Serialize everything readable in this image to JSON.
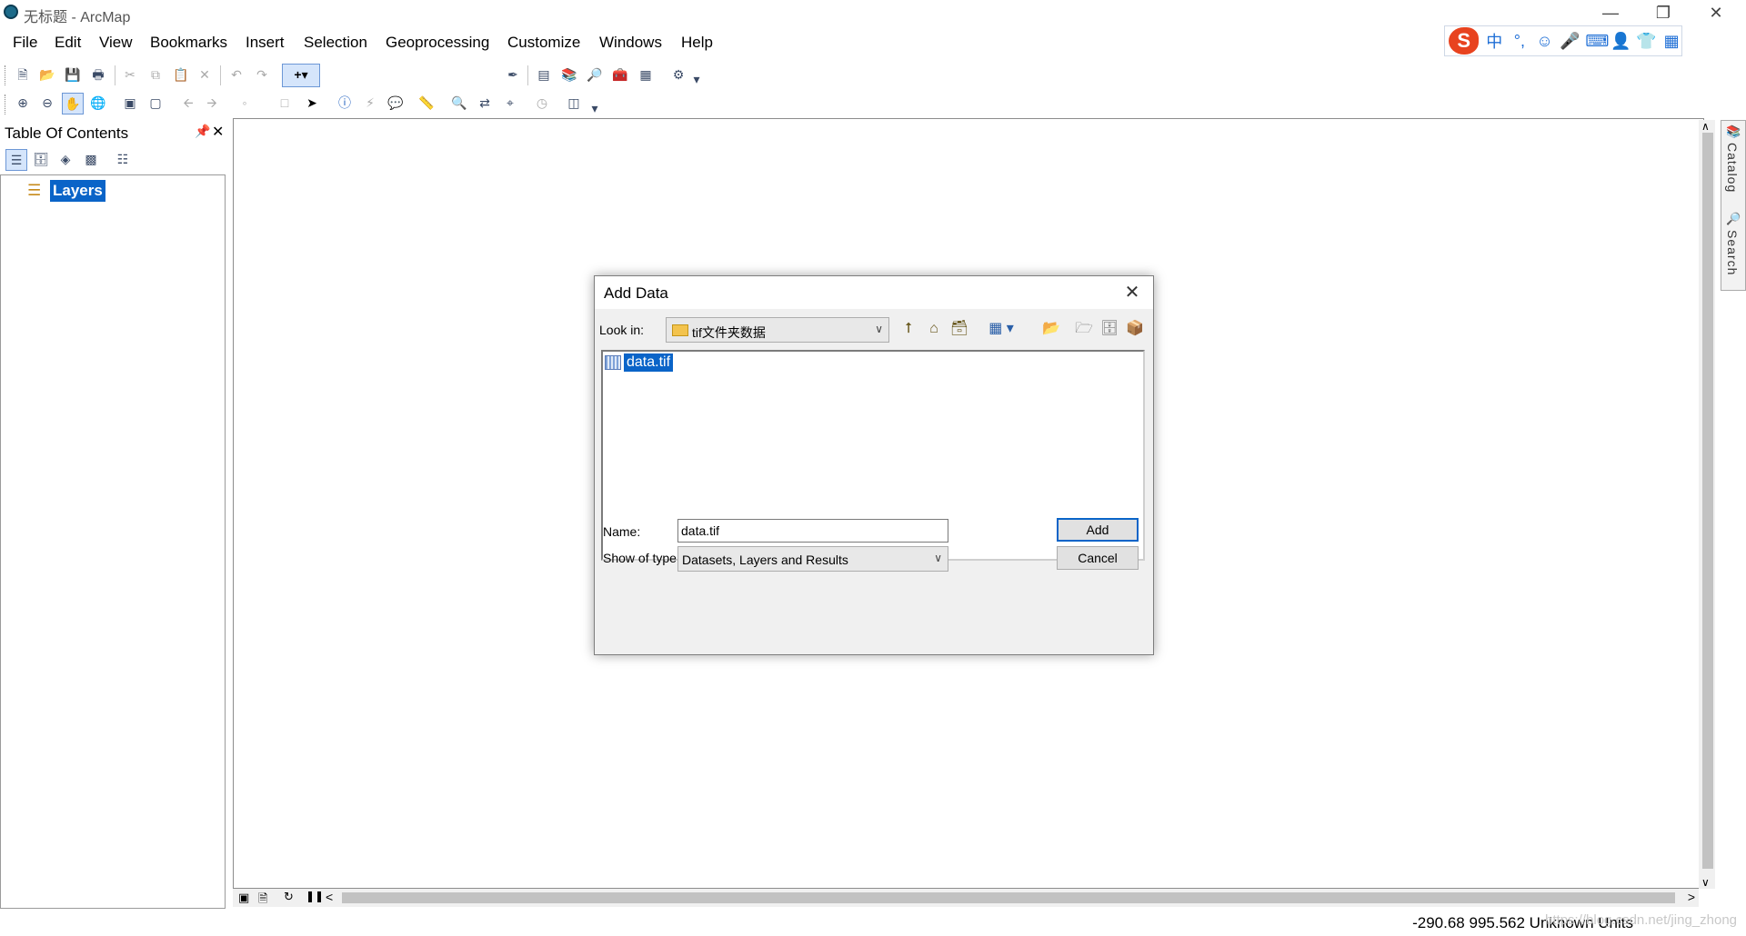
{
  "window": {
    "title": "无标题 - ArcMap",
    "minimize_icon": "minimize-icon",
    "restore_icon": "restore-icon",
    "close_icon": "close-icon"
  },
  "menu": [
    "File",
    "Edit",
    "View",
    "Bookmarks",
    "Insert",
    "Selection",
    "Geoprocessing",
    "Customize",
    "Windows",
    "Help"
  ],
  "ime": {
    "logo": "S",
    "lang": "中",
    "punct": "°,",
    "emoji": "☺",
    "mic": "🎤",
    "keyboard": "⌨",
    "user": "👤",
    "shirt": "👕",
    "grid": "▦"
  },
  "toc": {
    "title": "Table Of Contents",
    "pin": "ᵖ",
    "close": "✕",
    "root_layer": "Layers"
  },
  "dialog": {
    "title": "Add Data",
    "close": "✕",
    "look_in_label": "Look in:",
    "look_in_value": "tif文件夹数据",
    "files": [
      "data.tif"
    ],
    "name_label": "Name:",
    "name_value": "data.tif",
    "type_label": "Show of type:",
    "type_value": "Datasets, Layers and Results",
    "add_button": "Add",
    "cancel_button": "Cancel"
  },
  "dock": {
    "catalog": "Catalog",
    "search": "Search"
  },
  "status": {
    "coordinates": "-290.68  995.562 Unknown Units",
    "watermark": "https://blog.csdn.net/jing_zhong"
  },
  "colors": {
    "selection": "#0a64c8",
    "ime_logo": "#e8431f"
  }
}
